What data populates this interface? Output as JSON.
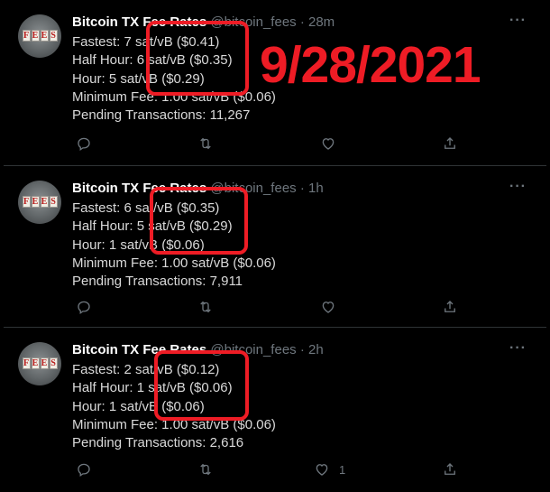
{
  "annotation": {
    "date": "9/28/2021",
    "color": "#ee1c25"
  },
  "tweets": [
    {
      "avatar_letters": [
        "F",
        "E",
        "E",
        "S"
      ],
      "name": "Bitcoin TX Fee Rates",
      "handle": "@bitcoin_fees",
      "dot": "·",
      "time": "28m",
      "more": "···",
      "lines": [
        "Fastest: 7 sat/vB ($0.41)",
        "Half Hour: 6 sat/vB ($0.35)",
        "Hour: 5 sat/vB ($0.29)",
        "Minimum Fee: 1.00 sat/vB ($0.06)",
        "Pending Transactions: 11,267"
      ],
      "like_count": ""
    },
    {
      "avatar_letters": [
        "F",
        "E",
        "E",
        "S"
      ],
      "name": "Bitcoin TX Fee Rates",
      "handle": "@bitcoin_fees",
      "dot": "·",
      "time": "1h",
      "more": "···",
      "lines": [
        "Fastest: 6 sat/vB ($0.35)",
        "Half Hour: 5 sat/vB ($0.29)",
        "Hour: 1 sat/vB ($0.06)",
        "Minimum Fee: 1.00 sat/vB ($0.06)",
        "Pending Transactions: 7,911"
      ],
      "like_count": ""
    },
    {
      "avatar_letters": [
        "F",
        "E",
        "E",
        "S"
      ],
      "name": "Bitcoin TX Fee Rates",
      "handle": "@bitcoin_fees",
      "dot": "·",
      "time": "2h",
      "more": "···",
      "lines": [
        "Fastest: 2 sat/vB ($0.12)",
        "Half Hour: 1 sat/vB ($0.06)",
        "Hour: 1 sat/vB ($0.06)",
        "Minimum Fee: 1.00 sat/vB ($0.06)",
        "Pending Transactions: 2,616"
      ],
      "like_count": "1"
    }
  ],
  "icons": [
    "reply-icon",
    "retweet-icon",
    "like-icon",
    "share-icon"
  ],
  "colors": {
    "background": "#000000",
    "text": "#d9d9d9",
    "muted": "#6e767d",
    "divider": "#2f3336"
  }
}
